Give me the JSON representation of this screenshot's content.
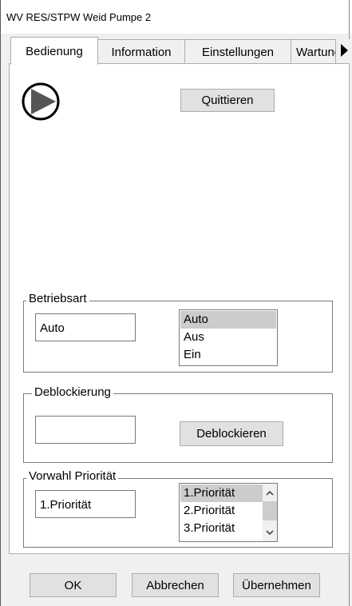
{
  "window": {
    "title": "WV RES/STPW Weid Pumpe 2"
  },
  "tabs": [
    {
      "label": "Bedienung",
      "active": true
    },
    {
      "label": "Information",
      "active": false
    },
    {
      "label": "Einstellungen",
      "active": false
    },
    {
      "label": "Wartung",
      "active": false
    }
  ],
  "pump": {
    "icon": "pump-icon"
  },
  "quit_button": "Quittieren",
  "betriebsart": {
    "title": "Betriebsart",
    "value": "Auto",
    "options": [
      "Auto",
      "Aus",
      "Ein"
    ],
    "selected": "Auto"
  },
  "deblockierung": {
    "title": "Deblockierung",
    "value": "",
    "button": "Deblockieren"
  },
  "vorwahl": {
    "title": "Vorwahl Priorität",
    "value": "1.Priorität",
    "options": [
      "1.Priorität",
      "2.Priorität",
      "3.Priorität"
    ],
    "selected": "1.Priorität"
  },
  "footer": {
    "ok": "OK",
    "cancel": "Abbrechen",
    "apply": "Übernehmen"
  }
}
